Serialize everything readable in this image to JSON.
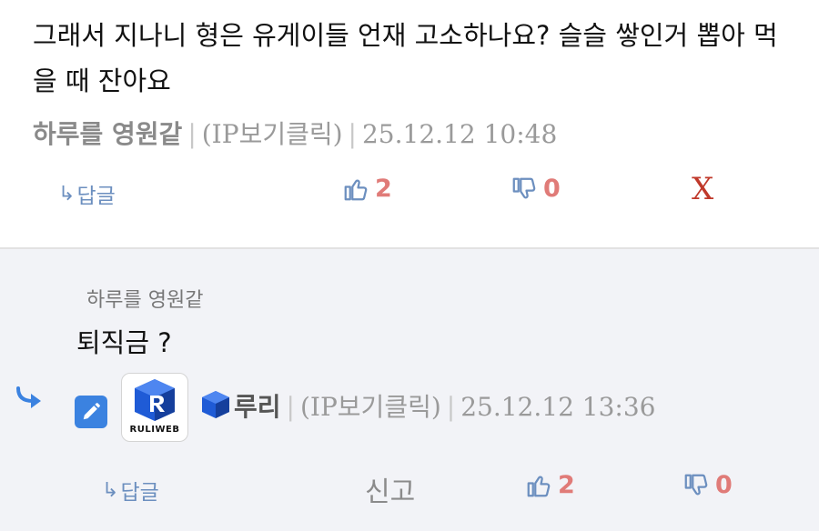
{
  "comment1": {
    "text": "그래서 지나니 형은 유게이들 언재 고소하나요? 슬슬 쌓인거 뽑아 먹을 때 잔아요",
    "nickname": "하루를 영원같",
    "ip_label": "(IP보기클릭)",
    "datetime": "25.12.12 10:48",
    "reply_label": "답글",
    "like_count": "2",
    "dislike_count": "0",
    "delete_label": "X"
  },
  "comment2": {
    "quoted_nickname": "하루를 영원같",
    "text": "퇴직금 ?",
    "avatar_brand": "RULIWEB",
    "nickname": "루리",
    "ip_label": "(IP보기클릭)",
    "datetime": "25.12.12 13:36",
    "reply_label": "답글",
    "report_label": "신고",
    "like_count": "2",
    "dislike_count": "0"
  },
  "colors": {
    "accent": "#3b82e0",
    "vote_count": "#e07b78",
    "vote_icon": "#6c8fbf",
    "delete": "#c0392b",
    "reply_bg": "#f2f3f7"
  },
  "icons": [
    "reply-arrow-icon",
    "thumbs-up-icon",
    "thumbs-down-icon",
    "pencil-icon",
    "ruliweb-logo-icon",
    "reply-indent-arrow-icon"
  ]
}
